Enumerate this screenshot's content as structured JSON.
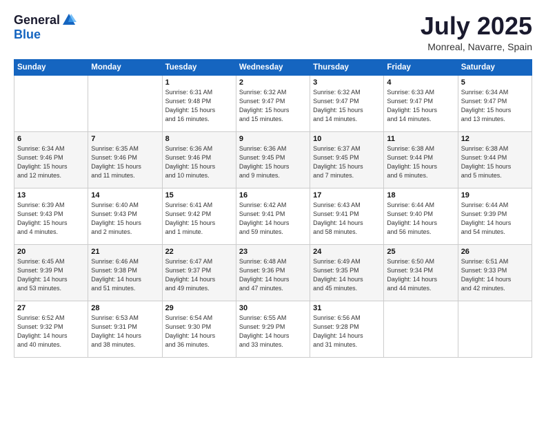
{
  "header": {
    "logo_general": "General",
    "logo_blue": "Blue",
    "month": "July 2025",
    "location": "Monreal, Navarre, Spain"
  },
  "weekdays": [
    "Sunday",
    "Monday",
    "Tuesday",
    "Wednesday",
    "Thursday",
    "Friday",
    "Saturday"
  ],
  "weeks": [
    [
      {
        "day": "",
        "text": ""
      },
      {
        "day": "",
        "text": ""
      },
      {
        "day": "1",
        "text": "Sunrise: 6:31 AM\nSunset: 9:48 PM\nDaylight: 15 hours\nand 16 minutes."
      },
      {
        "day": "2",
        "text": "Sunrise: 6:32 AM\nSunset: 9:47 PM\nDaylight: 15 hours\nand 15 minutes."
      },
      {
        "day": "3",
        "text": "Sunrise: 6:32 AM\nSunset: 9:47 PM\nDaylight: 15 hours\nand 14 minutes."
      },
      {
        "day": "4",
        "text": "Sunrise: 6:33 AM\nSunset: 9:47 PM\nDaylight: 15 hours\nand 14 minutes."
      },
      {
        "day": "5",
        "text": "Sunrise: 6:34 AM\nSunset: 9:47 PM\nDaylight: 15 hours\nand 13 minutes."
      }
    ],
    [
      {
        "day": "6",
        "text": "Sunrise: 6:34 AM\nSunset: 9:46 PM\nDaylight: 15 hours\nand 12 minutes."
      },
      {
        "day": "7",
        "text": "Sunrise: 6:35 AM\nSunset: 9:46 PM\nDaylight: 15 hours\nand 11 minutes."
      },
      {
        "day": "8",
        "text": "Sunrise: 6:36 AM\nSunset: 9:46 PM\nDaylight: 15 hours\nand 10 minutes."
      },
      {
        "day": "9",
        "text": "Sunrise: 6:36 AM\nSunset: 9:45 PM\nDaylight: 15 hours\nand 9 minutes."
      },
      {
        "day": "10",
        "text": "Sunrise: 6:37 AM\nSunset: 9:45 PM\nDaylight: 15 hours\nand 7 minutes."
      },
      {
        "day": "11",
        "text": "Sunrise: 6:38 AM\nSunset: 9:44 PM\nDaylight: 15 hours\nand 6 minutes."
      },
      {
        "day": "12",
        "text": "Sunrise: 6:38 AM\nSunset: 9:44 PM\nDaylight: 15 hours\nand 5 minutes."
      }
    ],
    [
      {
        "day": "13",
        "text": "Sunrise: 6:39 AM\nSunset: 9:43 PM\nDaylight: 15 hours\nand 4 minutes."
      },
      {
        "day": "14",
        "text": "Sunrise: 6:40 AM\nSunset: 9:43 PM\nDaylight: 15 hours\nand 2 minutes."
      },
      {
        "day": "15",
        "text": "Sunrise: 6:41 AM\nSunset: 9:42 PM\nDaylight: 15 hours\nand 1 minute."
      },
      {
        "day": "16",
        "text": "Sunrise: 6:42 AM\nSunset: 9:41 PM\nDaylight: 14 hours\nand 59 minutes."
      },
      {
        "day": "17",
        "text": "Sunrise: 6:43 AM\nSunset: 9:41 PM\nDaylight: 14 hours\nand 58 minutes."
      },
      {
        "day": "18",
        "text": "Sunrise: 6:44 AM\nSunset: 9:40 PM\nDaylight: 14 hours\nand 56 minutes."
      },
      {
        "day": "19",
        "text": "Sunrise: 6:44 AM\nSunset: 9:39 PM\nDaylight: 14 hours\nand 54 minutes."
      }
    ],
    [
      {
        "day": "20",
        "text": "Sunrise: 6:45 AM\nSunset: 9:39 PM\nDaylight: 14 hours\nand 53 minutes."
      },
      {
        "day": "21",
        "text": "Sunrise: 6:46 AM\nSunset: 9:38 PM\nDaylight: 14 hours\nand 51 minutes."
      },
      {
        "day": "22",
        "text": "Sunrise: 6:47 AM\nSunset: 9:37 PM\nDaylight: 14 hours\nand 49 minutes."
      },
      {
        "day": "23",
        "text": "Sunrise: 6:48 AM\nSunset: 9:36 PM\nDaylight: 14 hours\nand 47 minutes."
      },
      {
        "day": "24",
        "text": "Sunrise: 6:49 AM\nSunset: 9:35 PM\nDaylight: 14 hours\nand 45 minutes."
      },
      {
        "day": "25",
        "text": "Sunrise: 6:50 AM\nSunset: 9:34 PM\nDaylight: 14 hours\nand 44 minutes."
      },
      {
        "day": "26",
        "text": "Sunrise: 6:51 AM\nSunset: 9:33 PM\nDaylight: 14 hours\nand 42 minutes."
      }
    ],
    [
      {
        "day": "27",
        "text": "Sunrise: 6:52 AM\nSunset: 9:32 PM\nDaylight: 14 hours\nand 40 minutes."
      },
      {
        "day": "28",
        "text": "Sunrise: 6:53 AM\nSunset: 9:31 PM\nDaylight: 14 hours\nand 38 minutes."
      },
      {
        "day": "29",
        "text": "Sunrise: 6:54 AM\nSunset: 9:30 PM\nDaylight: 14 hours\nand 36 minutes."
      },
      {
        "day": "30",
        "text": "Sunrise: 6:55 AM\nSunset: 9:29 PM\nDaylight: 14 hours\nand 33 minutes."
      },
      {
        "day": "31",
        "text": "Sunrise: 6:56 AM\nSunset: 9:28 PM\nDaylight: 14 hours\nand 31 minutes."
      },
      {
        "day": "",
        "text": ""
      },
      {
        "day": "",
        "text": ""
      }
    ]
  ]
}
